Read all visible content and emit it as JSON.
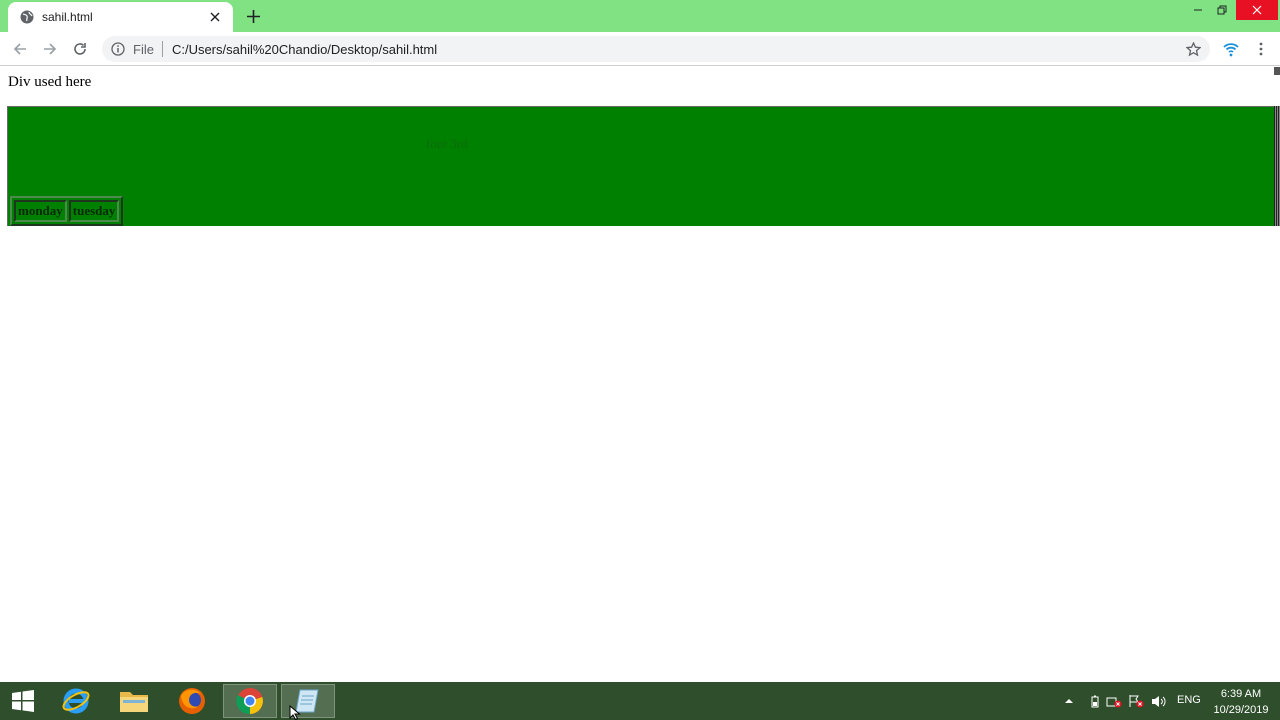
{
  "browser": {
    "tab_title": "sahil.html",
    "omnibox_chip": "File",
    "url": "C:/Users/sahil%20Chandio/Desktop/sahil.html",
    "accent_color": "#80e283"
  },
  "page": {
    "heading_text": "Div used here",
    "faint_text": "font 3rd",
    "div_color": "#008000",
    "table": {
      "cells": [
        "monday",
        "tuesday"
      ]
    }
  },
  "taskbar": {
    "apps": [
      {
        "name": "start-button",
        "icon": "windows-logo"
      },
      {
        "name": "internet-explorer",
        "icon": "ie-icon"
      },
      {
        "name": "file-explorer",
        "icon": "folder-icon"
      },
      {
        "name": "firefox",
        "icon": "firefox-icon"
      },
      {
        "name": "chrome",
        "icon": "chrome-icon"
      },
      {
        "name": "notepad",
        "icon": "notepad-icon"
      }
    ],
    "language": "ENG",
    "time": "6:39 AM",
    "date": "10/29/2019"
  }
}
